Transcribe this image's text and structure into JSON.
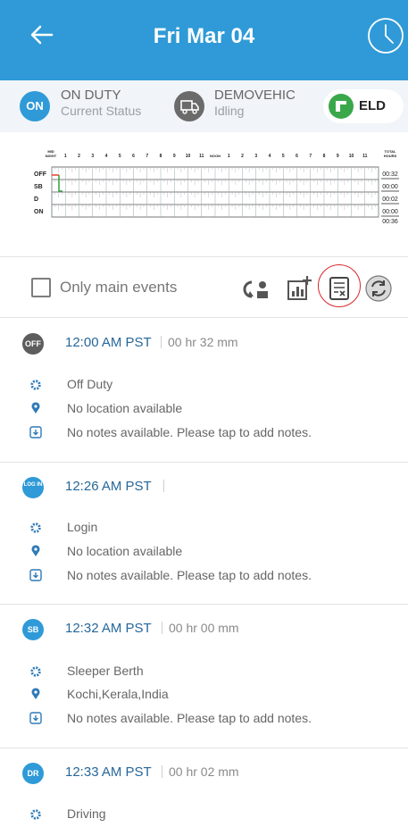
{
  "header": {
    "title": "Fri Mar 04",
    "back_icon": "arrow-left-icon",
    "clock_icon": "clock-icon",
    "bg": "#2f9ad7"
  },
  "status": {
    "badge": "ON",
    "duty_label": "ON DUTY",
    "duty_sub": "Current Status",
    "vehicle": "DEMOVEHIC",
    "vehicle_sub": "Idling",
    "eld": "ELD"
  },
  "graph": {
    "top_left": "MID NIGHT",
    "hours": [
      "1",
      "2",
      "3",
      "4",
      "5",
      "6",
      "7",
      "8",
      "9",
      "10",
      "11",
      "NOON",
      "1",
      "2",
      "3",
      "4",
      "5",
      "6",
      "7",
      "8",
      "9",
      "10",
      "11"
    ],
    "total_header": "TOTAL HOURS",
    "rows": [
      {
        "label": "OFF",
        "total": "00:32"
      },
      {
        "label": "SB",
        "total": "00:00"
      },
      {
        "label": "D",
        "total": "00:02"
      },
      {
        "label": "ON",
        "total": "00:00"
      }
    ],
    "grand_total": "00:36"
  },
  "filter": {
    "checkbox_label": "Only main events",
    "tools": [
      "edit-weather-icon",
      "add-chart-icon",
      "certify-log-icon",
      "sync-icon"
    ]
  },
  "events": [
    {
      "badge": "OFF",
      "badge_color": "#5d5d5d",
      "time": "12:00 AM PST",
      "duration": "00 hr 32 mm",
      "status": "Off Duty",
      "location": "No location available",
      "notes": "No notes available. Please tap to add notes."
    },
    {
      "badge": "LOG IN",
      "badge_color": "#2f9ad7",
      "time": "12:26 AM PST",
      "duration": "",
      "status": "Login",
      "location": "No location available",
      "notes": "No notes available. Please tap to add notes."
    },
    {
      "badge": "SB",
      "badge_color": "#2f9ad7",
      "time": "12:32 AM PST",
      "duration": "00 hr 00 mm",
      "status": "Sleeper Berth",
      "location": "Kochi,Kerala,India",
      "notes": "No notes available. Please tap to add notes."
    },
    {
      "badge": "DR",
      "badge_color": "#2f9ad7",
      "time": "12:33 AM PST",
      "duration": "00 hr 02 mm",
      "status": "Driving"
    }
  ]
}
